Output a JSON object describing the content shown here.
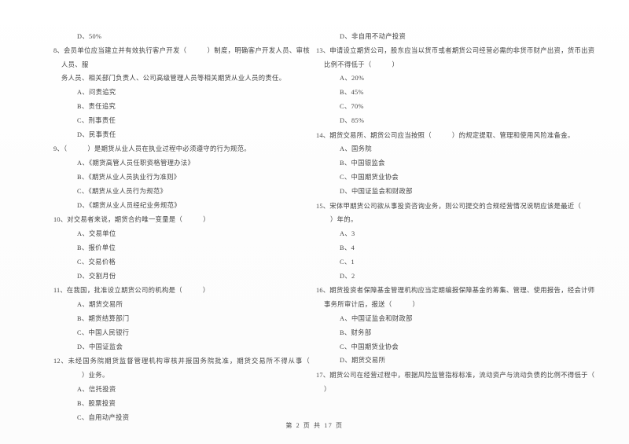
{
  "document": {
    "type": "exam-paper",
    "footer": "第 2 页 共 17 页",
    "page_number": "2",
    "total_pages": "17"
  },
  "left_column": {
    "orphan_option": "D、50%",
    "questions": [
      {
        "number": "8、",
        "stem_part1": "会员单位应当建立并有效执行客户开发（",
        "stem_part2": "）制度，明确客户开发人员、审核人员、服",
        "stem_part3": "务人员、相关部门负责人、公司高级管理人员等相关期货从业人员的责任。",
        "options": [
          "A、问责追究",
          "B、责任追究",
          "C、刑事责任",
          "D、民事责任"
        ]
      },
      {
        "number": "9、",
        "stem_part1": "（",
        "stem_part2": "）是期货从业人员在执业过程中必须遵守的行为规范。",
        "stem_part3": "",
        "options": [
          "A、《期货高管人员任职资格管理办法》",
          "B、《期货从业人员执业行为准则》",
          "C、《期货从业人员行为规范》",
          "D、《期货从业人员经纪业务规范》"
        ]
      },
      {
        "number": "10、",
        "stem_part1": "对交易者来说，期货合约唯一变量是（",
        "stem_part2": "）",
        "stem_part3": "",
        "options": [
          "A、交易单位",
          "B、报价单位",
          "C、交易价格",
          "D、交割月份"
        ]
      },
      {
        "number": "11、",
        "stem_part1": "在我国，批准设立期货公司的机构是（",
        "stem_part2": "）",
        "stem_part3": "",
        "options": [
          "A、期货交易所",
          "B、期货结算部门",
          "C、中国人民银行",
          "D、中国证监会"
        ]
      },
      {
        "number": "12、",
        "stem_part1": "未经国务院期货监督管理机构审核并报国务院批准，期货交易所不得从事（",
        "stem_part2": "）业务。",
        "stem_part3": "",
        "options": [
          "A、信托投资",
          "B、股票投资",
          "C、自用动产投资"
        ]
      }
    ]
  },
  "right_column": {
    "orphan_option": "D、非自用不动产投资",
    "questions": [
      {
        "number": "13、",
        "stem_part1": "申请设立期货公司，股东应当以货币或者期货公司经营必需的非货币财产出资，货币出资",
        "stem_part2": "比例不得低于（",
        "stem_part3": "）",
        "options": [
          "A、20%",
          "B、45%",
          "C、70%",
          "D、85%"
        ]
      },
      {
        "number": "14、",
        "stem_part1": "期货交易所、期货公司应当按照（",
        "stem_part2": "）的规定提取、管理和使用风险准备金。",
        "stem_part3": "",
        "options": [
          "A、国务院",
          "B、中国银监会",
          "C、中国期货业协会",
          "D、中国证监会和财政部"
        ]
      },
      {
        "number": "15、",
        "stem_part1": "宋体甲期货公司欲从事投资咨询业务，则公司提交的合规经营情况说明应该是最近（",
        "stem_part2": "）年的。",
        "stem_part3": "",
        "options": [
          "A、3",
          "B、4",
          "C、1",
          "D、2"
        ]
      },
      {
        "number": "16、",
        "stem_part1": "期货投资者保障基金管理机构应当定期编报保障基金的筹集、管理、使用报告，经会计师",
        "stem_part2": "事务所审计后，报送（",
        "stem_part3": "）",
        "options": [
          "A、中国证监会和财政部",
          "B、财务部",
          "C、中国期货业协会",
          "D、期货交易所"
        ]
      },
      {
        "number": "17、",
        "stem_part1": "期货公司在经营过程中，根据风险监管指标标准，流动资产与流动负债的比例不得低于（",
        "stem_part2": "）",
        "stem_part3": "",
        "options": []
      }
    ]
  }
}
